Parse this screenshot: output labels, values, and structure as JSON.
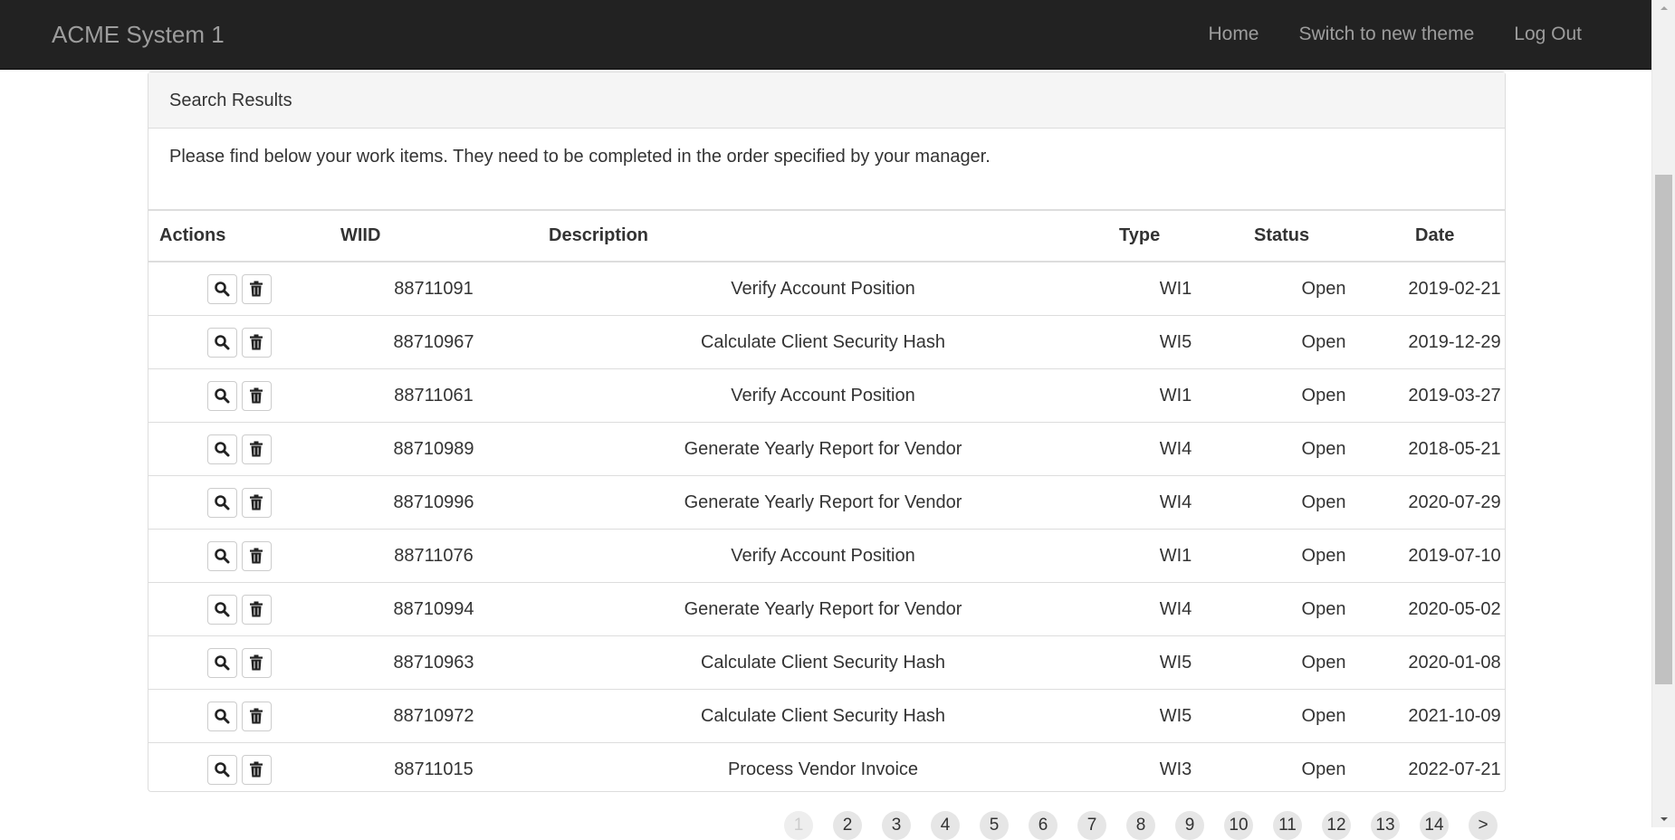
{
  "navbar": {
    "brand": "ACME System 1",
    "links": [
      "Home",
      "Switch to new theme",
      "Log Out"
    ]
  },
  "panel": {
    "heading": "Search Results",
    "intro": "Please find below your work items. They need to be completed in the order specified by your manager."
  },
  "table": {
    "columns": [
      "Actions",
      "WIID",
      "Description",
      "Type",
      "Status",
      "Date"
    ],
    "rows": [
      {
        "wiid": "88711091",
        "description": "Verify Account Position",
        "type": "WI1",
        "status": "Open",
        "date": "2019-02-21"
      },
      {
        "wiid": "88710967",
        "description": "Calculate Client Security Hash",
        "type": "WI5",
        "status": "Open",
        "date": "2019-12-29"
      },
      {
        "wiid": "88711061",
        "description": "Verify Account Position",
        "type": "WI1",
        "status": "Open",
        "date": "2019-03-27"
      },
      {
        "wiid": "88710989",
        "description": "Generate Yearly Report for Vendor",
        "type": "WI4",
        "status": "Open",
        "date": "2018-05-21"
      },
      {
        "wiid": "88710996",
        "description": "Generate Yearly Report for Vendor",
        "type": "WI4",
        "status": "Open",
        "date": "2020-07-29"
      },
      {
        "wiid": "88711076",
        "description": "Verify Account Position",
        "type": "WI1",
        "status": "Open",
        "date": "2019-07-10"
      },
      {
        "wiid": "88710994",
        "description": "Generate Yearly Report for Vendor",
        "type": "WI4",
        "status": "Open",
        "date": "2020-05-02"
      },
      {
        "wiid": "88710963",
        "description": "Calculate Client Security Hash",
        "type": "WI5",
        "status": "Open",
        "date": "2020-01-08"
      },
      {
        "wiid": "88710972",
        "description": "Calculate Client Security Hash",
        "type": "WI5",
        "status": "Open",
        "date": "2021-10-09"
      },
      {
        "wiid": "88711015",
        "description": "Process Vendor Invoice",
        "type": "WI3",
        "status": "Open",
        "date": "2022-07-21"
      }
    ],
    "row_action_icons": [
      "search-icon",
      "trash-icon"
    ]
  },
  "pagination": {
    "pages": [
      "1",
      "2",
      "3",
      "4",
      "5",
      "6",
      "7",
      "8",
      "9",
      "10",
      "11",
      "12",
      "13",
      "14",
      ">"
    ],
    "active": "1"
  }
}
